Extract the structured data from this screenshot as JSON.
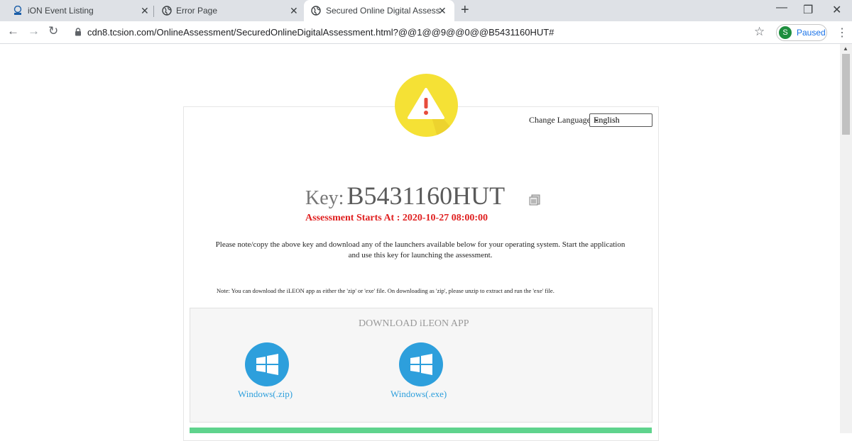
{
  "browser": {
    "tabs": [
      {
        "title": "iON Event Listing",
        "icon": "tcs-icon"
      },
      {
        "title": "Error Page",
        "icon": "globe-icon"
      },
      {
        "title": "Secured Online Digital Assessme",
        "icon": "globe-icon",
        "active": true
      }
    ],
    "url": "cdn8.tcsion.com/OnlineAssessment/SecuredOnlineDigitalAssessment.html?@@1@@9@@0@@B5431160HUT#",
    "profile_initial": "S",
    "profile_status": "Paused"
  },
  "page": {
    "change_language_label": "Change Language",
    "language_selected": "English",
    "key_label": "Key:",
    "key_value": "B5431160HUT",
    "assessment_starts": "Assessment Starts At : 2020-10-27 08:00:00",
    "instruction": "Please note/copy the above key and download any of the launchers available below for your operating system. Start the application and use this key for launching the assessment.",
    "note": "Note: You can download the iLEON app as either the 'zip' or 'exe' file. On downloading as 'zip', please unzip to extract and run the 'exe' file.",
    "download_title": "DOWNLOAD iLEON APP",
    "downloads": [
      {
        "label": "Windows(.zip)"
      },
      {
        "label": "Windows(.exe)"
      }
    ]
  },
  "colors": {
    "warning": "#f5e135",
    "accent": "#2d9fdc",
    "start_text": "#e02020",
    "bottom_bar": "#5fd38d"
  }
}
